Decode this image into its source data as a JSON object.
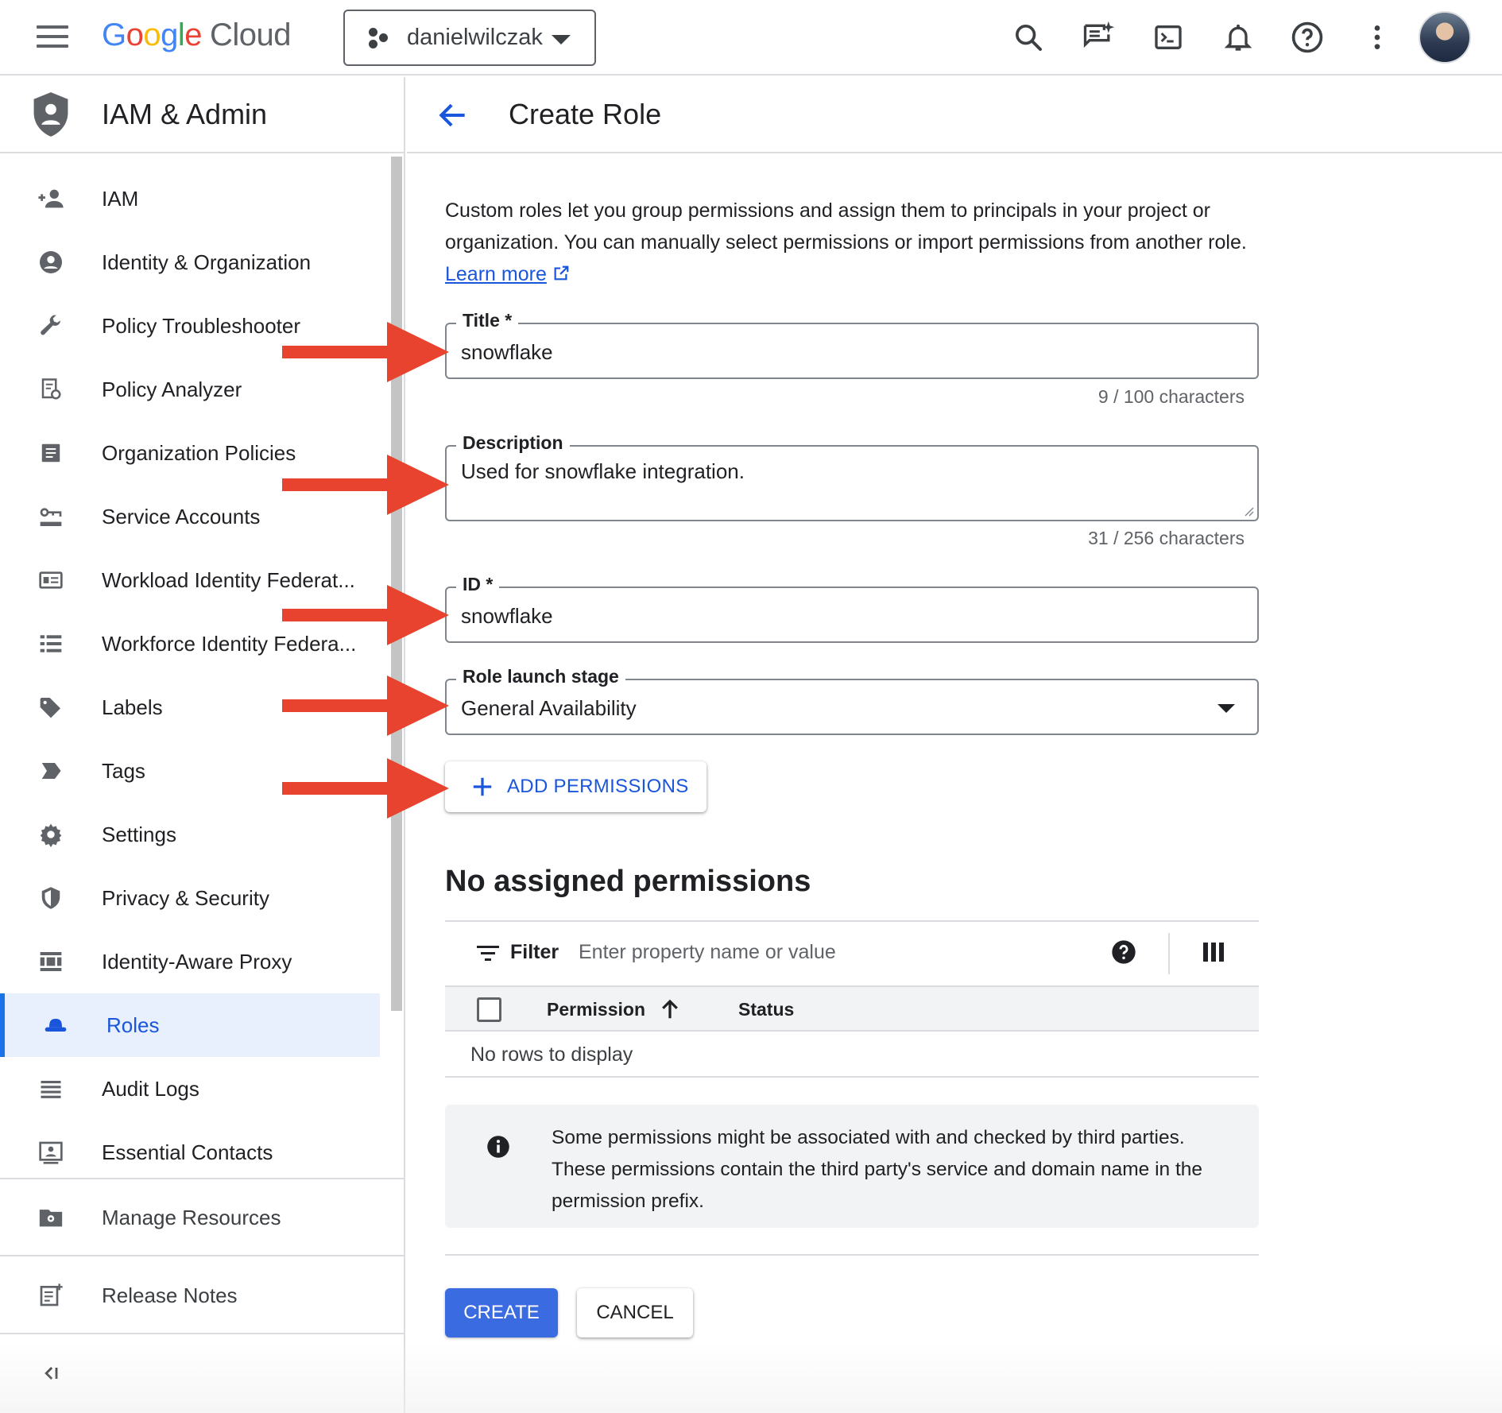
{
  "topbar": {
    "logo_google": [
      "G",
      "o",
      "o",
      "g",
      "l",
      "e"
    ],
    "logo_product": "Cloud",
    "project_name": "danielwilczak",
    "icons": [
      "search-icon",
      "gemini-chat-icon",
      "cloud-shell-icon",
      "notifications-icon",
      "help-icon",
      "more-vert-icon"
    ]
  },
  "sidebar": {
    "title": "IAM & Admin",
    "items": [
      {
        "label": "IAM",
        "icon": "person-add-icon"
      },
      {
        "label": "Identity & Organization",
        "icon": "account-circle-icon"
      },
      {
        "label": "Policy Troubleshooter",
        "icon": "wrench-icon"
      },
      {
        "label": "Policy Analyzer",
        "icon": "policy-analyzer-icon"
      },
      {
        "label": "Organization Policies",
        "icon": "document-icon"
      },
      {
        "label": "Service Accounts",
        "icon": "service-account-icon"
      },
      {
        "label": "Workload Identity Federat...",
        "icon": "workload-identity-icon"
      },
      {
        "label": "Workforce Identity Federa...",
        "icon": "list-icon"
      },
      {
        "label": "Labels",
        "icon": "label-icon"
      },
      {
        "label": "Tags",
        "icon": "tag-icon"
      },
      {
        "label": "Settings",
        "icon": "gear-icon"
      },
      {
        "label": "Privacy & Security",
        "icon": "shield-icon"
      },
      {
        "label": "Identity-Aware Proxy",
        "icon": "proxy-icon"
      },
      {
        "label": "Roles",
        "icon": "hat-icon",
        "active": true
      },
      {
        "label": "Audit Logs",
        "icon": "lines-icon"
      },
      {
        "label": "Essential Contacts",
        "icon": "contact-card-icon"
      }
    ],
    "manage_resources": "Manage Resources",
    "release_notes": "Release Notes",
    "collapse_label": "<I"
  },
  "main": {
    "page_title": "Create Role",
    "intro_text": "Custom roles let you group permissions and assign them to principals in your project or organization. You can manually select permissions or import permissions from another role.",
    "learn_more": "Learn more",
    "title_field": {
      "label": "Title *",
      "value": "snowflake",
      "counter": "9 / 100 characters"
    },
    "description_field": {
      "label": "Description",
      "value": "Used for snowflake integration.",
      "counter": "31 / 256 characters"
    },
    "id_field": {
      "label": "ID *",
      "value": "snowflake"
    },
    "launch_stage_field": {
      "label": "Role launch stage",
      "value": "General Availability"
    },
    "add_permissions": "ADD PERMISSIONS",
    "no_permissions_heading": "No assigned permissions",
    "table": {
      "filter_label": "Filter",
      "filter_placeholder": "Enter property name or value",
      "columns": [
        "Permission",
        "Status"
      ],
      "empty_text": "No rows to display"
    },
    "info_text": "Some permissions might be associated with and checked by third parties. These permissions contain the third party's service and domain name in the permission prefix.",
    "create_button": "CREATE",
    "cancel_button": "CANCEL"
  },
  "colors": {
    "accent_blue": "#1a56db",
    "annotation_arrow": "#e8432e",
    "active_nav_bg": "#e8f0fe"
  }
}
